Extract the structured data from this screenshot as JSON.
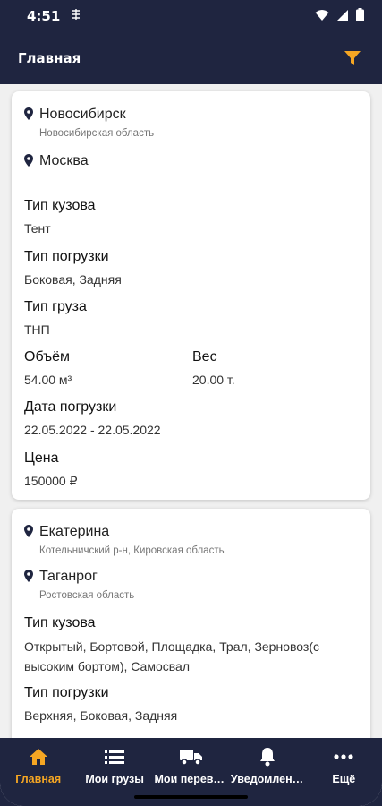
{
  "status_bar": {
    "time": "4:51"
  },
  "app_bar": {
    "title": "Главная"
  },
  "colors": {
    "primary_dark": "#1f2540",
    "accent": "#f5a623"
  },
  "cards": [
    {
      "from_city": "Новосибирск",
      "from_region": "Новосибирская область",
      "to_city": "Москва",
      "to_region": "",
      "body_type_label": "Тип кузова",
      "body_type": "Тент",
      "loading_type_label": "Тип погрузки",
      "loading_type": "Боковая, Задняя",
      "cargo_type_label": "Тип груза",
      "cargo_type": "ТНП",
      "volume_label": "Объём",
      "volume": "54.00 м³",
      "weight_label": "Вес",
      "weight": "20.00 т.",
      "date_label": "Дата погрузки",
      "date": "22.05.2022 - 22.05.2022",
      "price_label": "Цена",
      "price": "150000 ₽"
    },
    {
      "from_city": "Екатерина",
      "from_region": "Котельничский р-н, Кировская область",
      "to_city": "Таганрог",
      "to_region": "Ростовская область",
      "body_type_label": "Тип кузова",
      "body_type": "Открытый, Бортовой, Площадка, Трал, Зерновоз(с высоким бортом), Самосвал",
      "loading_type_label": "Тип погрузки",
      "loading_type": "Верхняя, Боковая, Задняя"
    }
  ],
  "bottom_nav": [
    {
      "label": "Главная",
      "icon": "home-icon",
      "active": true
    },
    {
      "label": "Мои грузы",
      "icon": "list-icon",
      "active": false
    },
    {
      "label": "Мои перевозки",
      "icon": "truck-icon",
      "active": false
    },
    {
      "label": "Уведомления",
      "icon": "bell-icon",
      "active": false
    },
    {
      "label": "Ещё",
      "icon": "more-icon",
      "active": false
    }
  ]
}
